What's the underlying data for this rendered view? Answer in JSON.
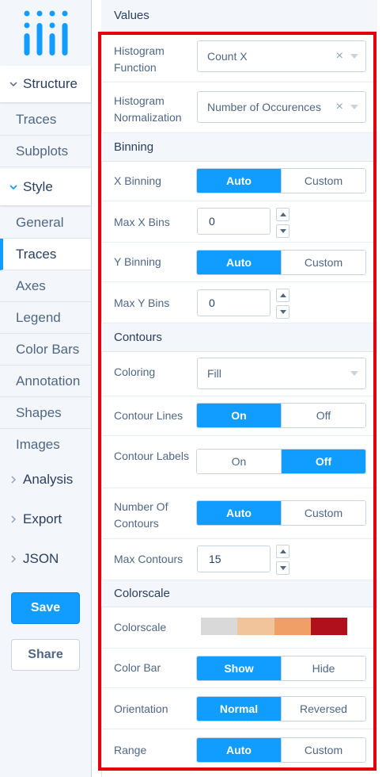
{
  "sidebar": {
    "logo": "plotly-logo-icon",
    "groups": {
      "structure": "Structure",
      "style": "Style",
      "analysis": "Analysis",
      "export": "Export",
      "json": "JSON"
    },
    "items": {
      "traces_structure": "Traces",
      "subplots": "Subplots",
      "general": "General",
      "traces_style": "Traces",
      "axes": "Axes",
      "legend": "Legend",
      "color_bars": "Color Bars",
      "annotation": "Annotation",
      "shapes": "Shapes",
      "images": "Images"
    },
    "save": "Save",
    "share": "Share"
  },
  "panel": {
    "values_header": "Values",
    "histogram_function": {
      "label": "Histogram Function",
      "value": "Count X",
      "clear": "×"
    },
    "histogram_normalization": {
      "label": "Histogram Normalization",
      "value": "Number of Occurences",
      "clear": "×"
    },
    "binning_header": "Binning",
    "x_binning": {
      "label": "X Binning",
      "options": [
        "Auto",
        "Custom"
      ],
      "selected": "Auto"
    },
    "max_x_bins": {
      "label": "Max X Bins",
      "value": "0"
    },
    "y_binning": {
      "label": "Y Binning",
      "options": [
        "Auto",
        "Custom"
      ],
      "selected": "Auto"
    },
    "max_y_bins": {
      "label": "Max Y Bins",
      "value": "0"
    },
    "contours_header": "Contours",
    "coloring": {
      "label": "Coloring",
      "value": "Fill"
    },
    "contour_lines": {
      "label": "Contour Lines",
      "options": [
        "On",
        "Off"
      ],
      "selected": "On"
    },
    "contour_labels": {
      "label": "Contour Labels",
      "options": [
        "On",
        "Off"
      ],
      "selected": "Off"
    },
    "number_of_contours": {
      "label": "Number Of Contours",
      "options": [
        "Auto",
        "Custom"
      ],
      "selected": "Auto"
    },
    "max_contours": {
      "label": "Max Contours",
      "value": "15"
    },
    "colorscale_header": "Colorscale",
    "colorscale": {
      "label": "Colorscale",
      "colors": [
        "#d9d9d9",
        "#f2c49b",
        "#f0a066",
        "#b0101c"
      ]
    },
    "color_bar": {
      "label": "Color Bar",
      "options": [
        "Show",
        "Hide"
      ],
      "selected": "Show"
    },
    "orientation": {
      "label": "Orientation",
      "options": [
        "Normal",
        "Reversed"
      ],
      "selected": "Normal"
    },
    "range": {
      "label": "Range",
      "options": [
        "Auto",
        "Custom"
      ],
      "selected": "Auto"
    }
  },
  "colors": {
    "accent": "#119dff",
    "highlight": "#e3000f",
    "text": "#506784",
    "heading": "#2a3f5f"
  }
}
